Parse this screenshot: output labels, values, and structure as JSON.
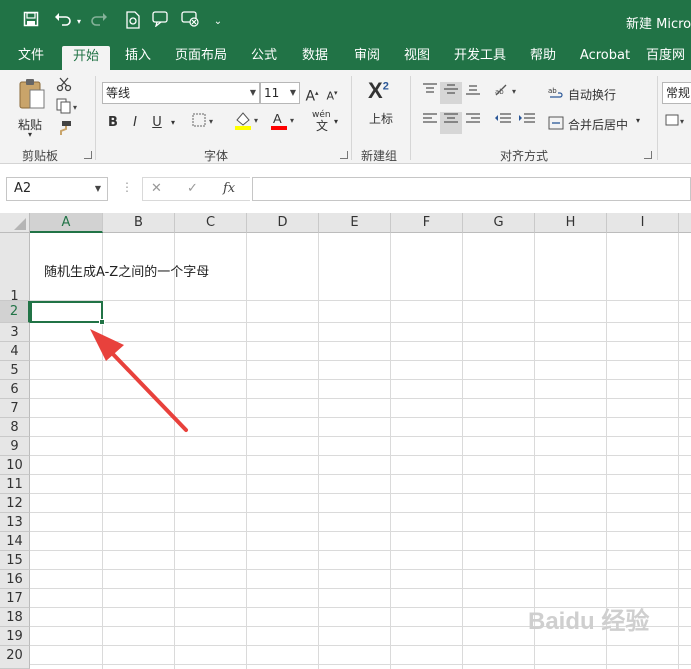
{
  "app": {
    "title": "新建 Micros",
    "quick_access": {
      "save_icon": "save-icon",
      "undo_icon": "undo-icon",
      "redo_icon": "redo-icon",
      "more": "⌄"
    }
  },
  "tabs": [
    "文件",
    "开始",
    "插入",
    "页面布局",
    "公式",
    "数据",
    "审阅",
    "视图",
    "开发工具",
    "帮助",
    "Acrobat",
    "百度网"
  ],
  "active_tab": "开始",
  "ribbon": {
    "clipboard": {
      "paste_label": "粘贴",
      "group_label": "剪贴板"
    },
    "font": {
      "font_name": "等线",
      "font_size": "11",
      "grow": "A",
      "shrink": "A",
      "bold": "B",
      "italic": "I",
      "underline": "U",
      "wen": "wén",
      "group_label": "字体",
      "fill_color": "#ffff00",
      "font_color": "#ff0000"
    },
    "new_group": {
      "superscript_label": "上标",
      "group_label": "新建组"
    },
    "alignment": {
      "wrap_label": "自动换行",
      "merge_label": "合并后居中",
      "group_label": "对齐方式"
    },
    "number": {
      "format_value": "常规"
    }
  },
  "formula_bar": {
    "name_box": "A2",
    "cancel": "✕",
    "enter": "✓",
    "fx": "fx",
    "value": ""
  },
  "sheet": {
    "columns": [
      "A",
      "B",
      "C",
      "D",
      "E",
      "F",
      "G",
      "H",
      "I"
    ],
    "rows": [
      "1",
      "2",
      "3",
      "4",
      "5",
      "6",
      "7",
      "8",
      "9",
      "10",
      "11",
      "12",
      "13",
      "14",
      "15",
      "16",
      "17",
      "18",
      "19",
      "20"
    ],
    "selected_cell": "A2",
    "cells": {
      "A1": "随机生成A-Z之间的一个字母"
    }
  },
  "watermark": "Baidu 经验",
  "colors": {
    "excel_green": "#217346",
    "annotation_arrow": "#e8413c"
  }
}
